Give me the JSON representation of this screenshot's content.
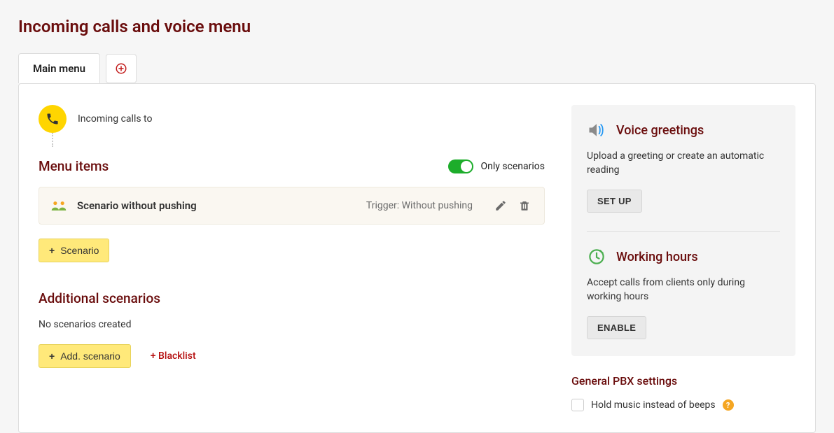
{
  "page": {
    "title": "Incoming calls and voice menu"
  },
  "tabs": {
    "main": "Main menu"
  },
  "incoming": {
    "label": "Incoming calls to"
  },
  "menu_items": {
    "heading": "Menu items",
    "only_scenarios_label": "Only scenarios",
    "scenario_row": {
      "name": "Scenario without pushing",
      "trigger": "Trigger: Without pushing"
    },
    "add_button": "Scenario"
  },
  "additional": {
    "heading": "Additional scenarios",
    "empty": "No scenarios created",
    "add_button": "Add. scenario",
    "blacklist": "+ Blacklist"
  },
  "side": {
    "voice_greetings": {
      "title": "Voice greetings",
      "desc": "Upload a greeting or create an automatic reading",
      "button": "SET UP"
    },
    "working_hours": {
      "title": "Working hours",
      "desc": "Accept calls from clients only during working hours",
      "button": "ENABLE"
    },
    "general": {
      "title": "General PBX settings",
      "hold_music_label": "Hold music instead of beeps"
    }
  }
}
